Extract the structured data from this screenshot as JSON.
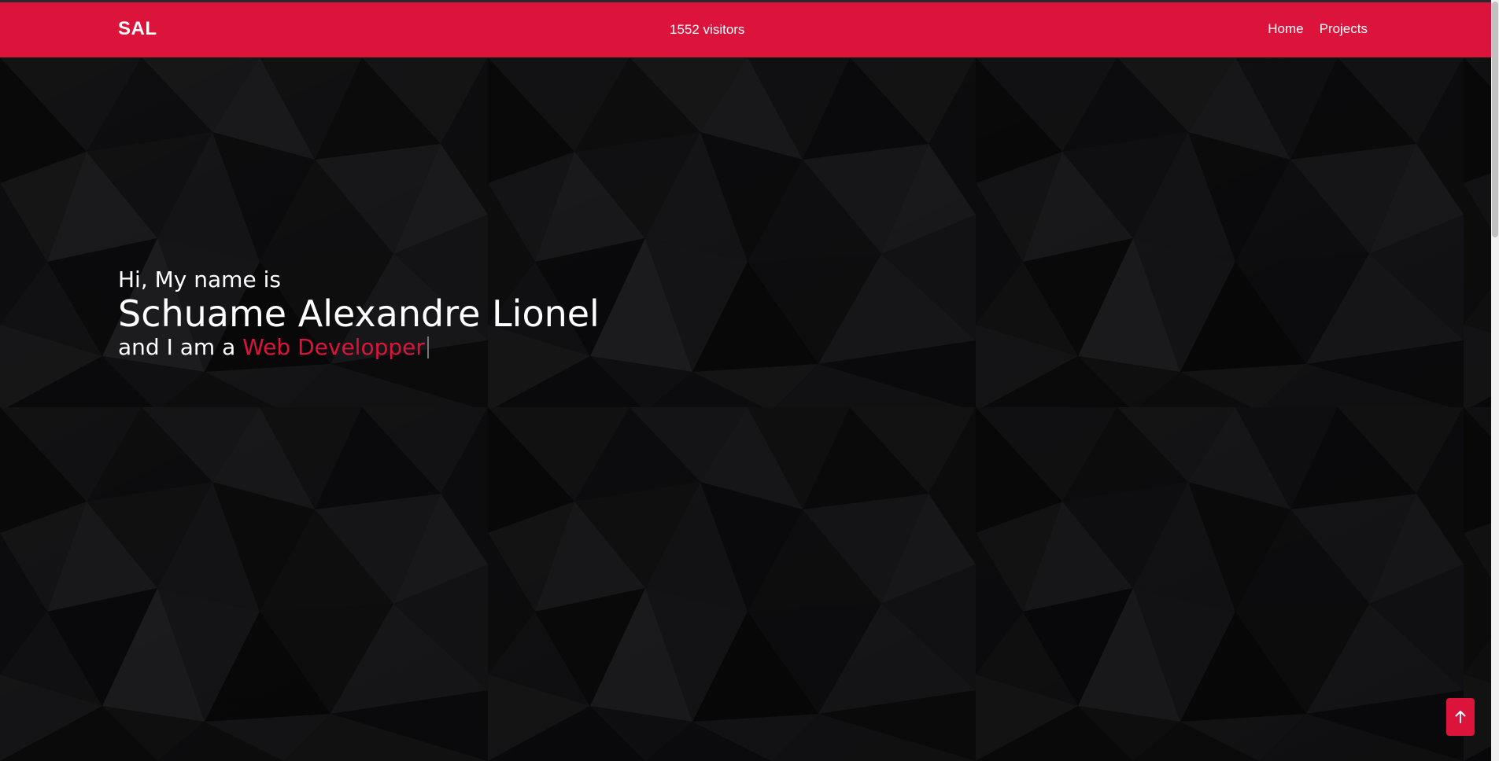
{
  "navbar": {
    "brand": "SAL",
    "visitors": "1552 visitors",
    "links": [
      {
        "label": "Home"
      },
      {
        "label": "Projects"
      }
    ]
  },
  "hero": {
    "greeting": "Hi, My name is",
    "name": "Schuame Alexandre Lionel",
    "role_prefix": "and I am a",
    "role": "Web Developper"
  },
  "icons": {
    "to_top": "arrow-up-icon"
  },
  "colors": {
    "accent": "#dc143c",
    "background": "#111113",
    "text": "#ffffff"
  }
}
